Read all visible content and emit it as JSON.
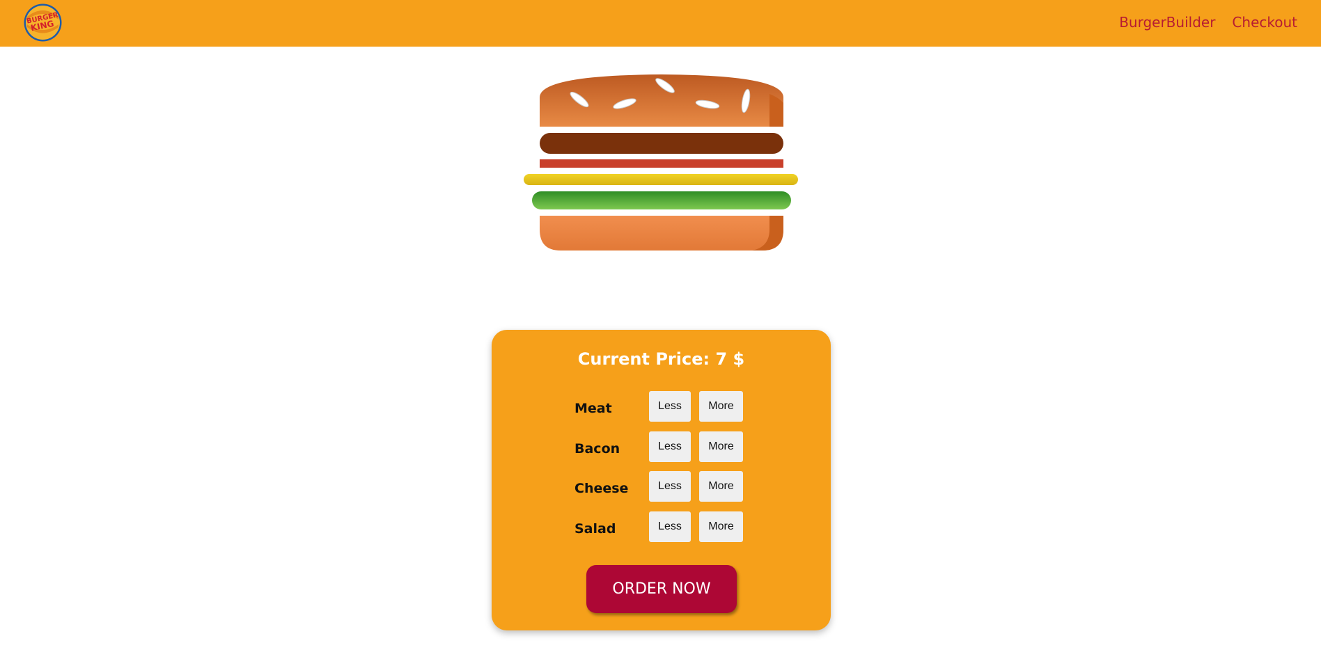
{
  "header": {
    "logo_text": "BURGER KING",
    "nav": [
      {
        "label": "BurgerBuilder"
      },
      {
        "label": "Checkout"
      }
    ]
  },
  "panel": {
    "price_text": "Current Price: 7 $",
    "ingredients": [
      {
        "label": "Meat",
        "less": "Less",
        "more": "More"
      },
      {
        "label": "Bacon",
        "less": "Less",
        "more": "More"
      },
      {
        "label": "Cheese",
        "less": "Less",
        "more": "More"
      },
      {
        "label": "Salad",
        "less": "Less",
        "more": "More"
      }
    ],
    "order_label": "ORDER NOW"
  },
  "colors": {
    "header_bg": "#f6a01a",
    "nav_text": "#b71c32",
    "panel_bg": "#f6a01a",
    "order_button": "#ad0735"
  }
}
